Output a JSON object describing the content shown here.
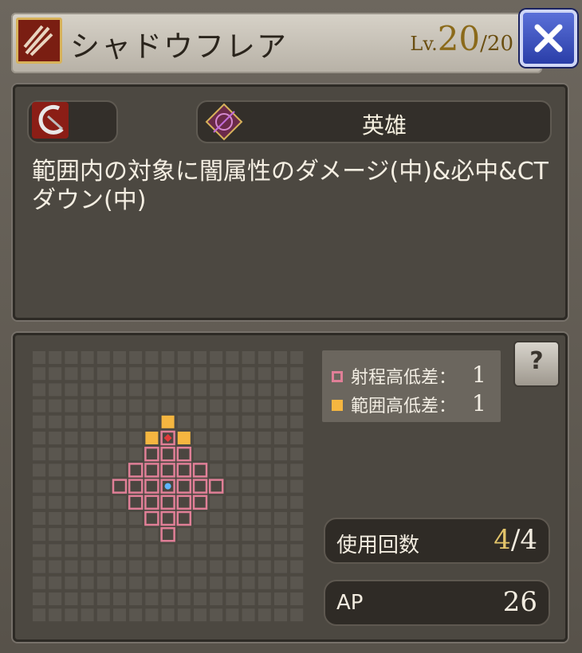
{
  "header": {
    "skill_name": "シャドウフレア",
    "level_prefix": "Lv.",
    "level_current": "20",
    "level_max": "/20"
  },
  "info": {
    "rank_label": "英雄",
    "description": "範囲内の対象に闇属性のダメージ(中)&必中&CTダウン(中)"
  },
  "legend": {
    "range_height_label": "射程高低差：",
    "range_height_value": "1",
    "area_height_label": "範囲高低差：",
    "area_height_value": "1"
  },
  "stats": {
    "uses_label": "使用回数",
    "uses_current": "4",
    "uses_max": "/4",
    "ap_label": "AP",
    "ap_value": "26"
  },
  "colors": {
    "range_cell": "#e07f97",
    "area_cell": "#f5b640",
    "center_cell": "#5fb5ff"
  },
  "icons": [
    "skill-type-icon",
    "weapon-icon",
    "rank-icon",
    "close-icon",
    "help-icon"
  ]
}
